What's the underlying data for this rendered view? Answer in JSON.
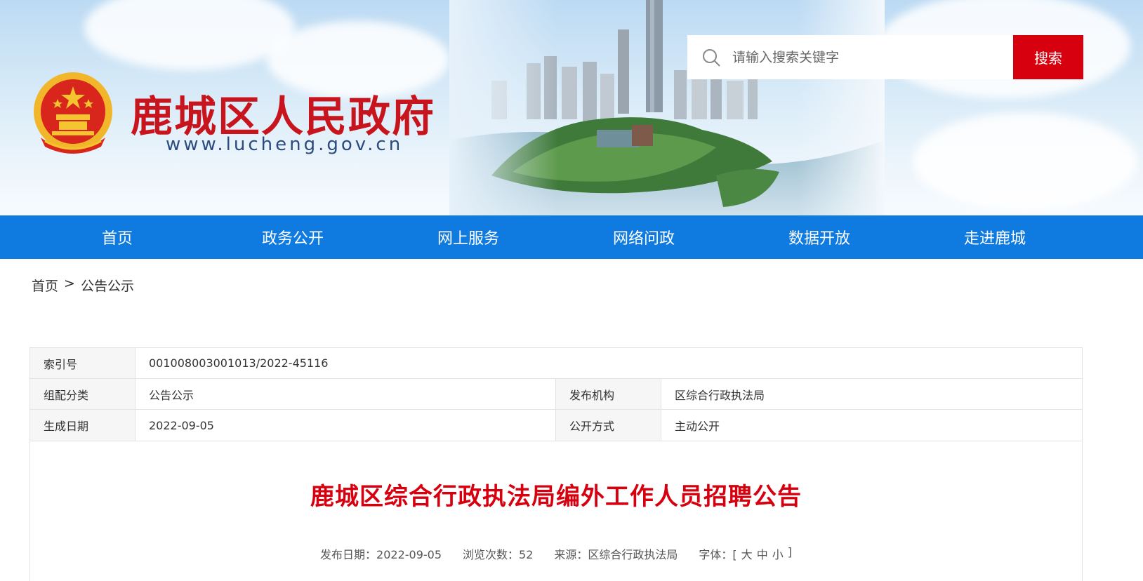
{
  "header": {
    "site_title": "鹿城区人民政府",
    "site_url": "www.lucheng.gov.cn",
    "search": {
      "placeholder": "请输入搜索关键字",
      "button_label": "搜索"
    }
  },
  "nav": {
    "items": [
      "首页",
      "政务公开",
      "网上服务",
      "网络问政",
      "数据开放",
      "走进鹿城"
    ]
  },
  "breadcrumb": {
    "home": "首页",
    "separator": ">",
    "current": "公告公示"
  },
  "meta": {
    "index_label": "索引号",
    "index_value": "001008003001013/2022-45116",
    "category_label": "组配分类",
    "category_value": "公告公示",
    "publisher_label": "发布机构",
    "publisher_value": "区综合行政执法局",
    "date_label": "生成日期",
    "date_value": "2022-09-05",
    "disclosure_label": "公开方式",
    "disclosure_value": "主动公开"
  },
  "article": {
    "title": "鹿城区综合行政执法局编外工作人员招聘公告",
    "publish_date": "发布日期：2022-09-05",
    "views": "浏览次数：52",
    "source": "来源：区综合行政执法局",
    "font_label": "字体：[",
    "font_large": "大",
    "font_medium": "中",
    "font_small": "小",
    "font_close": "]"
  },
  "colors": {
    "brand_red": "#d7000f",
    "nav_blue": "#0f7be0",
    "title_red": "#c8151d"
  }
}
